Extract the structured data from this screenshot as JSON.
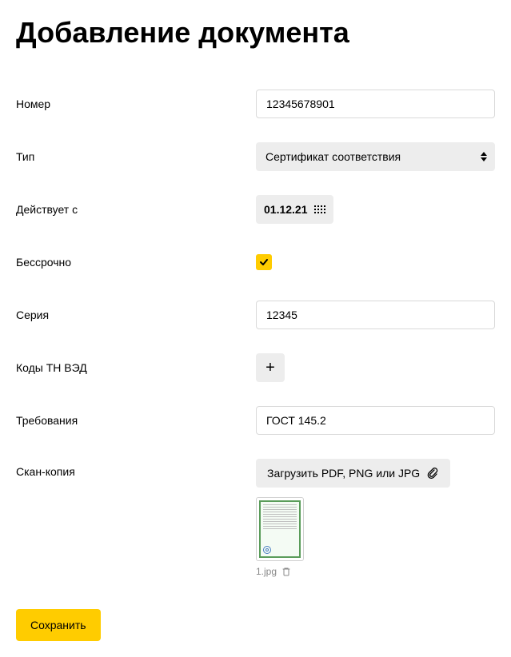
{
  "page_title": "Добавление документа",
  "form": {
    "number": {
      "label": "Номер",
      "value": "12345678901"
    },
    "type": {
      "label": "Тип",
      "value": "Сертификат соответствия"
    },
    "valid_from": {
      "label": "Действует с",
      "value": "01.12.21"
    },
    "unlimited": {
      "label": "Бессрочно",
      "checked": true
    },
    "series": {
      "label": "Серия",
      "value": "12345"
    },
    "tnved_codes": {
      "label": "Коды ТН ВЭД"
    },
    "requirements": {
      "label": "Требования",
      "value": "ГОСТ 145.2"
    },
    "scan_copy": {
      "label": "Скан-копия",
      "upload_label": "Загрузить PDF, PNG или JPG",
      "file_name": "1.jpg"
    }
  },
  "save_button": "Сохранить"
}
